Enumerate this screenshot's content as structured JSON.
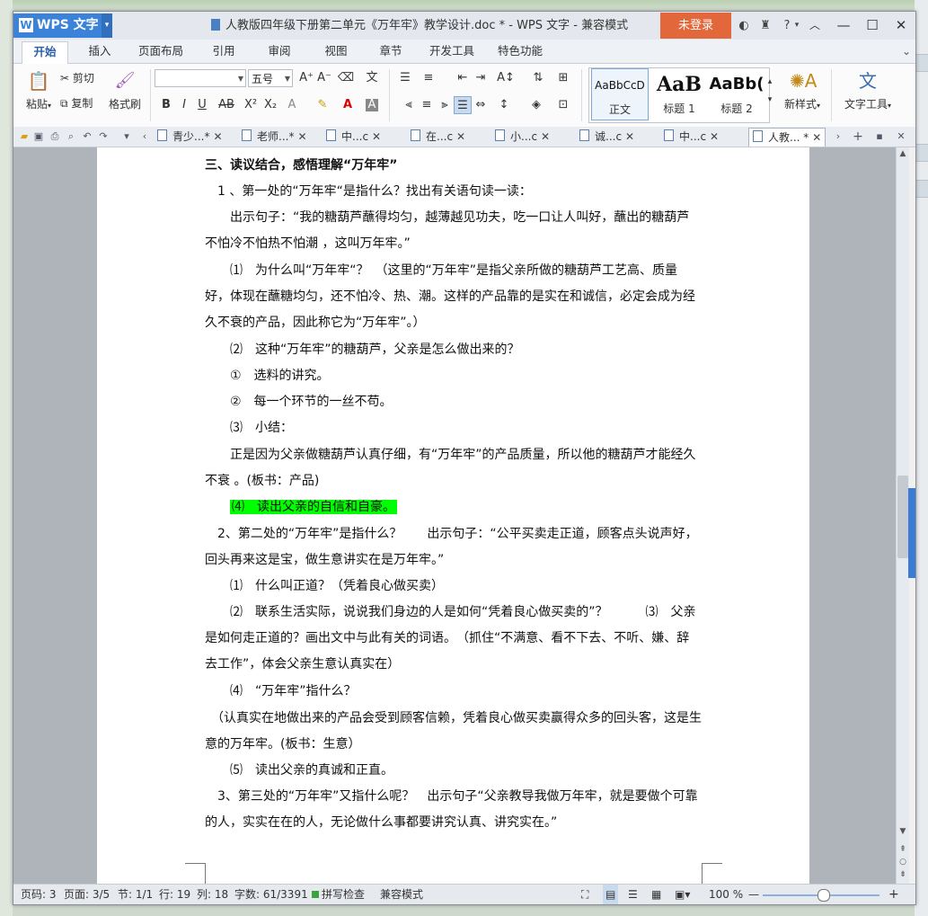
{
  "app": {
    "logo_w": "W",
    "logo_text": "WPS 文字",
    "title": "人教版四年级下册第二单元《万年牢》教学设计.doc * - WPS 文字 - 兼容模式",
    "login": "未登录"
  },
  "title_icons": [
    "skin-icon",
    "shirt-icon",
    "help-icon",
    "dropdown-icon"
  ],
  "menu_tabs": [
    "开始",
    "插入",
    "页面布局",
    "引用",
    "审阅",
    "视图",
    "章节",
    "开发工具",
    "特色功能"
  ],
  "ribbon": {
    "paste": "粘贴",
    "cut": "剪切",
    "copy": "复制",
    "format_painter": "格式刷",
    "font_name": "",
    "font_size": "五号",
    "styles": [
      {
        "preview": "AaBbCcD",
        "label": "正文"
      },
      {
        "preview": "AaB",
        "label": "标题 1"
      },
      {
        "preview": "AaBb(",
        "label": "标题 2"
      }
    ],
    "new_style": "新样式",
    "text_tools": "文字工具"
  },
  "doc_tabs": [
    {
      "label": "青少...*"
    },
    {
      "label": "老师...*"
    },
    {
      "label": "中...c"
    },
    {
      "label": "在...c"
    },
    {
      "label": "小...c"
    },
    {
      "label": "诚...c"
    },
    {
      "label": "中...c"
    },
    {
      "label": "人教... *"
    }
  ],
  "document": {
    "paragraphs": [
      "三、读议结合，感悟理解“万年牢”",
      "　1 、第一处的“万年牢“是指什么？找出有关语句读一读：",
      "　　出示句子：“我的糖葫芦蘸得均匀，越薄越见功夫，吃一口让人叫好，蘸出的糖葫芦不怕冷不怕热不怕潮 ，这叫万年牢。”",
      "　　⑴　为什么叫“万年牢“？　（这里的“万年牢”是指父亲所做的糖葫芦工艺高、质量好，体现在蘸糖均匀，还不怕冷、热、潮。这样的产品靠的是实在和诚信，必定会成为经久不衰的产品，因此称它为“万年牢”。）",
      "　　⑵　这种“万年牢”的糖葫芦，父亲是怎么做出来的？",
      "　　①　选料的讲究。",
      "　　②　每一个环节的一丝不苟。",
      "　　⑶　小结：",
      "　　正是因为父亲做糖葫芦认真仔细，有“万年牢”的产品质量，所以他的糖葫芦才能经久不衰 。(板书：产品)",
      "⑷　读出父亲的自信和自豪。",
      "　2、第二处的“万年牢”是指什么？　　出示句子：“公平买卖走正道，顾客点头说声好，回头再来这是宝，做生意讲实在是万年牢。”",
      "　　⑴　什么叫正道？（凭着良心做买卖）",
      "　　⑵　联系生活实际，说说我们身边的人是如何“凭着良心做买卖的”？　　　⑶　父亲是如何走正道的？画出文中与此有关的词语。　（抓住“不满意、看不下去、不听、嫌、辞去工作”，体会父亲生意认真实在）",
      "　　⑷　“万年牢”指什么？",
      "　（认真实在地做出来的产品会受到顾客信赖，凭着良心做买卖赢得众多的回头客，这是生意的万年牢。(板书：生意）",
      "　　⑸　读出父亲的真诚和正直。",
      "　3、第三处的“万年牢”又指什么呢？　出示句子“父亲教导我做万年牢，就是要做个可靠的人，实实在在的人，无论做什么事都要讲究认真、讲究实在。”"
    ]
  },
  "status": {
    "page_code": "页码: 3",
    "page": "页面: 3/5",
    "section": "节: 1/1",
    "row": "行: 19",
    "col": "列: 18",
    "words": "字数: 61/3391",
    "spell": "拼写检查",
    "compat": "兼容模式",
    "zoom": "100 %"
  }
}
